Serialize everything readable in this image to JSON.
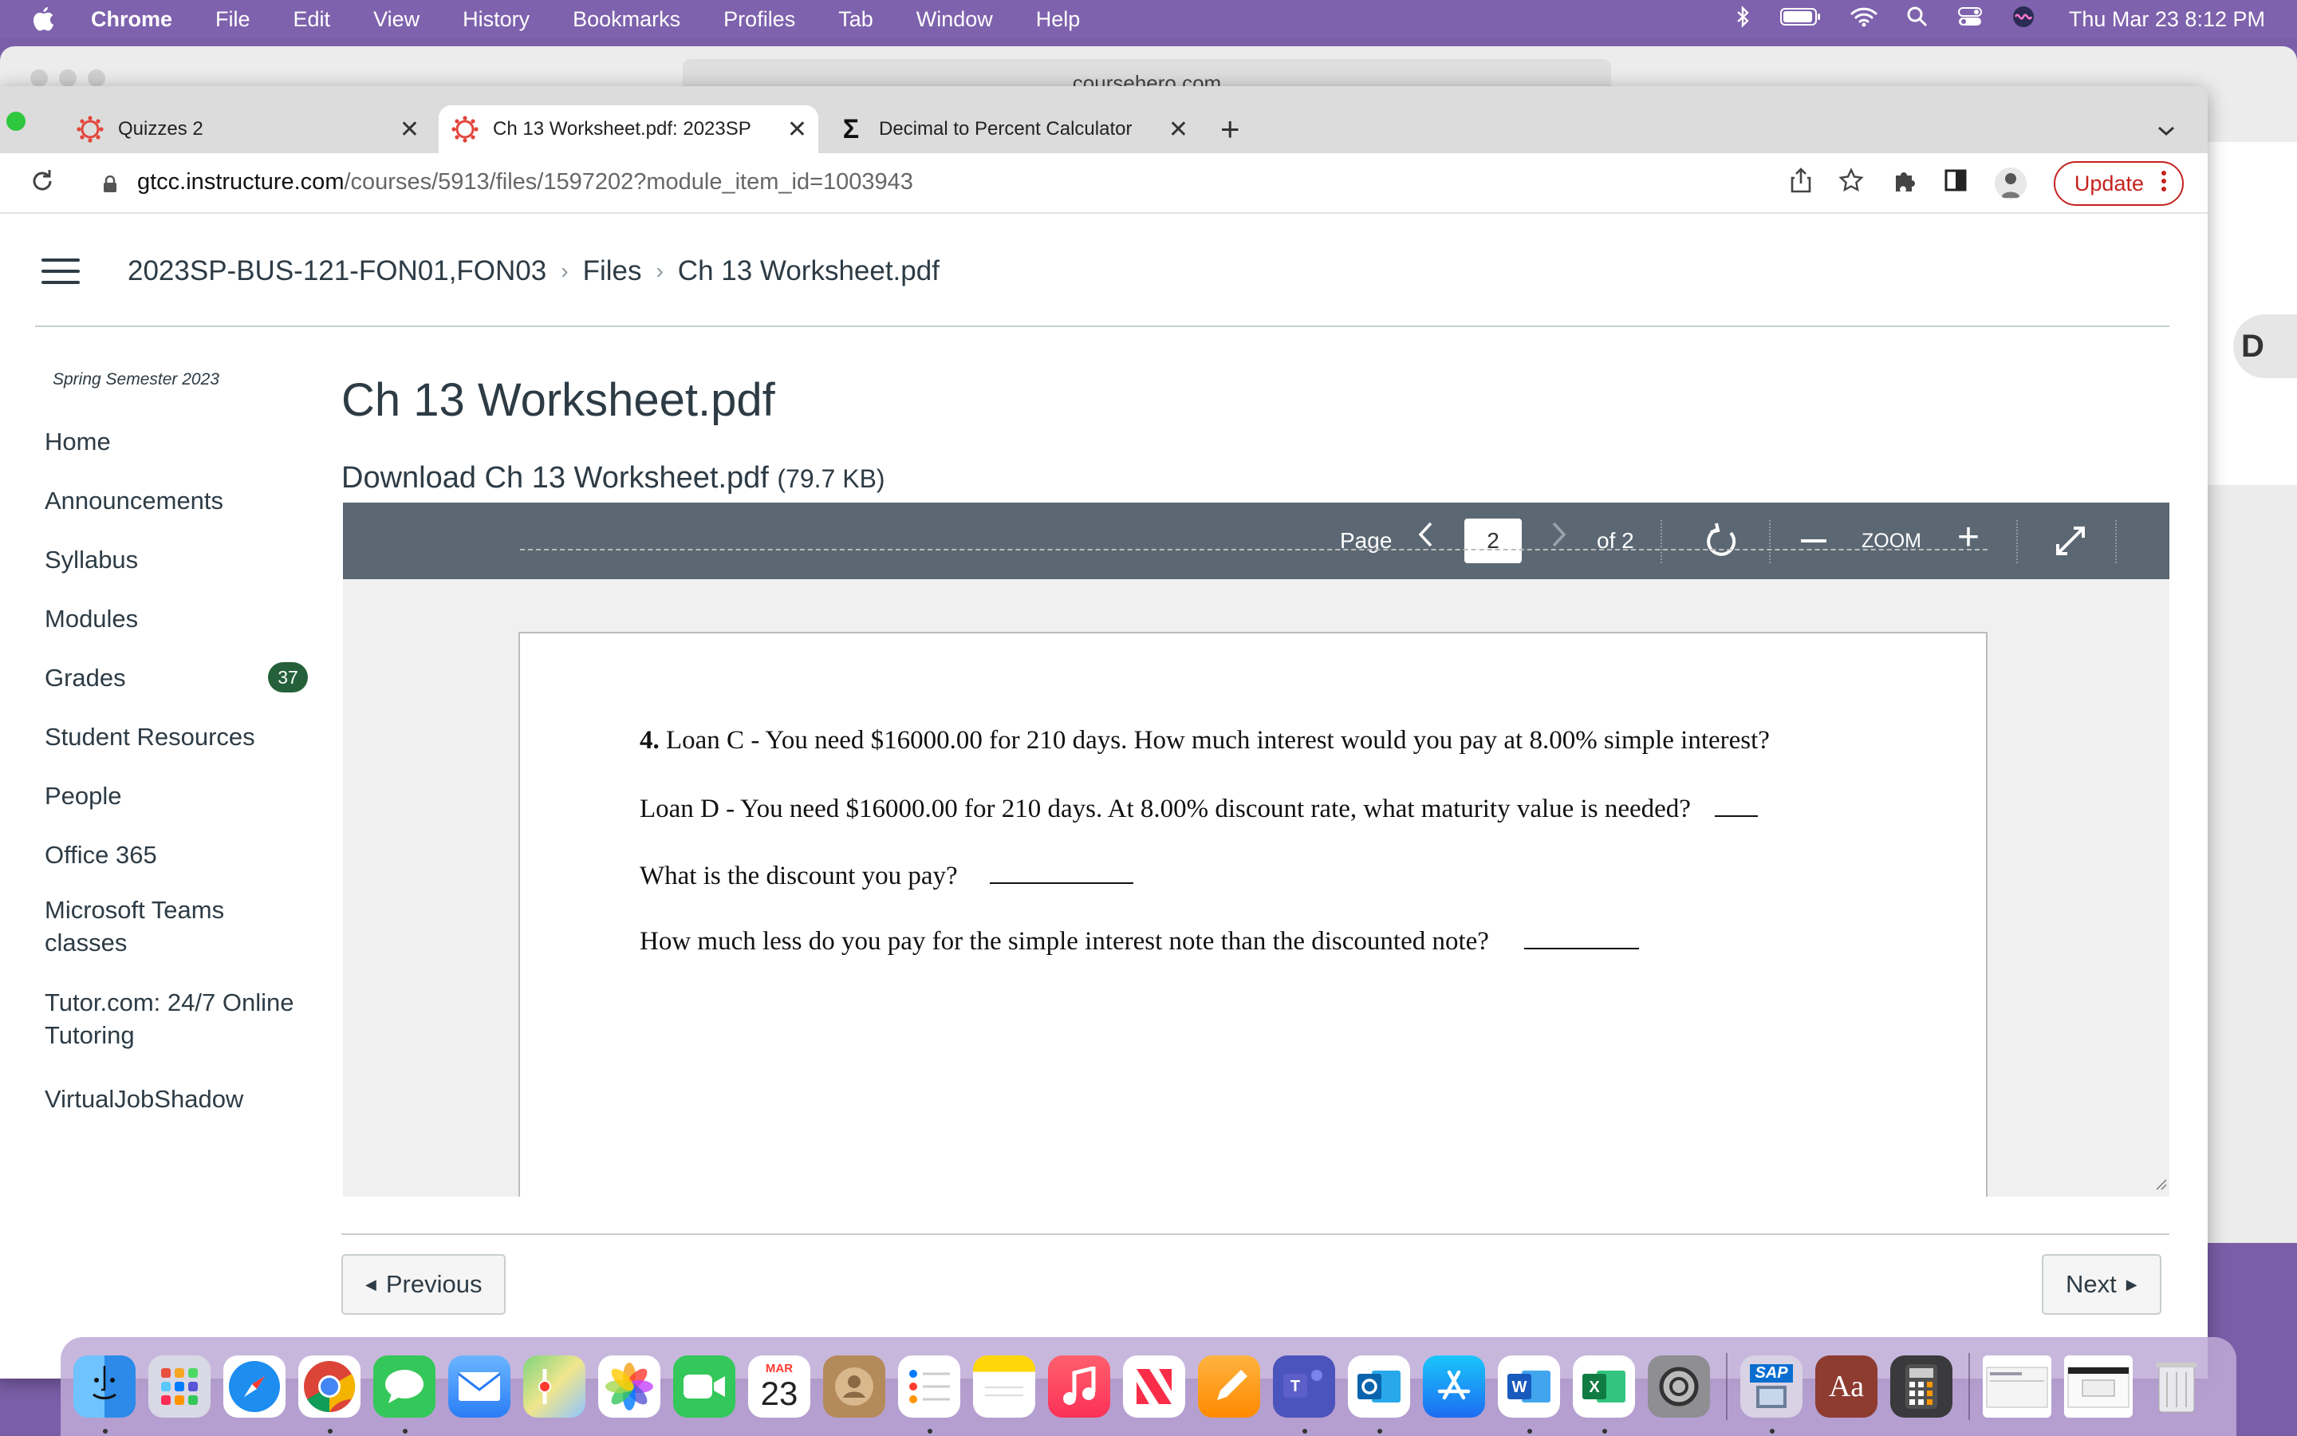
{
  "menubar": {
    "app": "Chrome",
    "items": [
      "File",
      "Edit",
      "View",
      "History",
      "Bookmarks",
      "Profiles",
      "Tab",
      "Window",
      "Help"
    ],
    "clock": "Thu Mar 23  8:12 PM"
  },
  "back_window": {
    "url": "coursehero.com",
    "avatar_letter": "D"
  },
  "tabs": [
    {
      "label": "Quizzes 2",
      "icon": "canvas-icon"
    },
    {
      "label": "Ch 13 Worksheet.pdf: 2023SP",
      "icon": "canvas-icon",
      "active": true
    },
    {
      "label": "Decimal to Percent Calculator",
      "icon": "sigma-icon"
    }
  ],
  "address": {
    "host": "gtcc.instructure.com",
    "path": "/courses/5913/files/1597202?module_item_id=1003943",
    "update_label": "Update"
  },
  "breadcrumb": [
    "2023SP-BUS-121-FON01,FON03",
    "Files",
    "Ch 13 Worksheet.pdf"
  ],
  "sidebar": {
    "term": "Spring Semester 2023",
    "items": [
      {
        "label": "Home"
      },
      {
        "label": "Announcements"
      },
      {
        "label": "Syllabus"
      },
      {
        "label": "Modules"
      },
      {
        "label": "Grades",
        "badge": "37"
      },
      {
        "label": "Student Resources"
      },
      {
        "label": "People"
      },
      {
        "label": "Office 365"
      },
      {
        "label": "Microsoft Teams classes"
      },
      {
        "label": "Tutor.com: 24/7 Online Tutoring"
      },
      {
        "label": "VirtualJobShadow"
      }
    ]
  },
  "main": {
    "title": "Ch 13 Worksheet.pdf",
    "download_label": "Download Ch 13 Worksheet.pdf",
    "download_size": "(79.7 KB)"
  },
  "viewer": {
    "page_label": "Page",
    "current_page": "2",
    "of_label": "of 2",
    "zoom_label": "ZOOM"
  },
  "document": {
    "q4_number": "4.",
    "q4_text": "Loan C - You need $16000.00 for 210 days.  How much interest would you pay at 8.00% simple interest?",
    "loan_d": "Loan D - You need $16000.00 for 210 days.  At 8.00% discount rate, what maturity value is needed?",
    "discount_q": "What is the discount you pay?",
    "less_q": "How much less do you pay for the simple interest note than the discounted note?"
  },
  "footer_nav": {
    "previous": "Previous",
    "next": "Next"
  },
  "dock": {
    "calendar_month": "MAR",
    "calendar_day": "23",
    "sap_label": "SAP",
    "dictionary_label": "Aa"
  }
}
